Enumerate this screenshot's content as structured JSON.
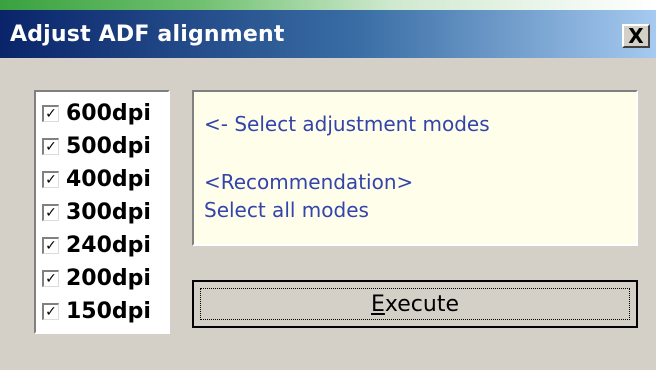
{
  "window": {
    "title": "Adjust ADF alignment",
    "close_label": "X"
  },
  "dpi_options": [
    {
      "label": "600dpi",
      "checked": true
    },
    {
      "label": "500dpi",
      "checked": true
    },
    {
      "label": "400dpi",
      "checked": true
    },
    {
      "label": "300dpi",
      "checked": true
    },
    {
      "label": "240dpi",
      "checked": true
    },
    {
      "label": "200dpi",
      "checked": true
    },
    {
      "label": "150dpi",
      "checked": true
    }
  ],
  "info": {
    "line1": "<- Select adjustment modes",
    "line2": "<Recommendation>",
    "line3": "Select all modes"
  },
  "execute": {
    "mnemonic": "E",
    "label_rest": "xecute"
  },
  "colors": {
    "title_bar_start": "#0a246a",
    "title_bar_end": "#a6caf0",
    "dialog_bg": "#d4d0c8",
    "info_bg": "#fffeea",
    "info_text": "#3344aa"
  }
}
